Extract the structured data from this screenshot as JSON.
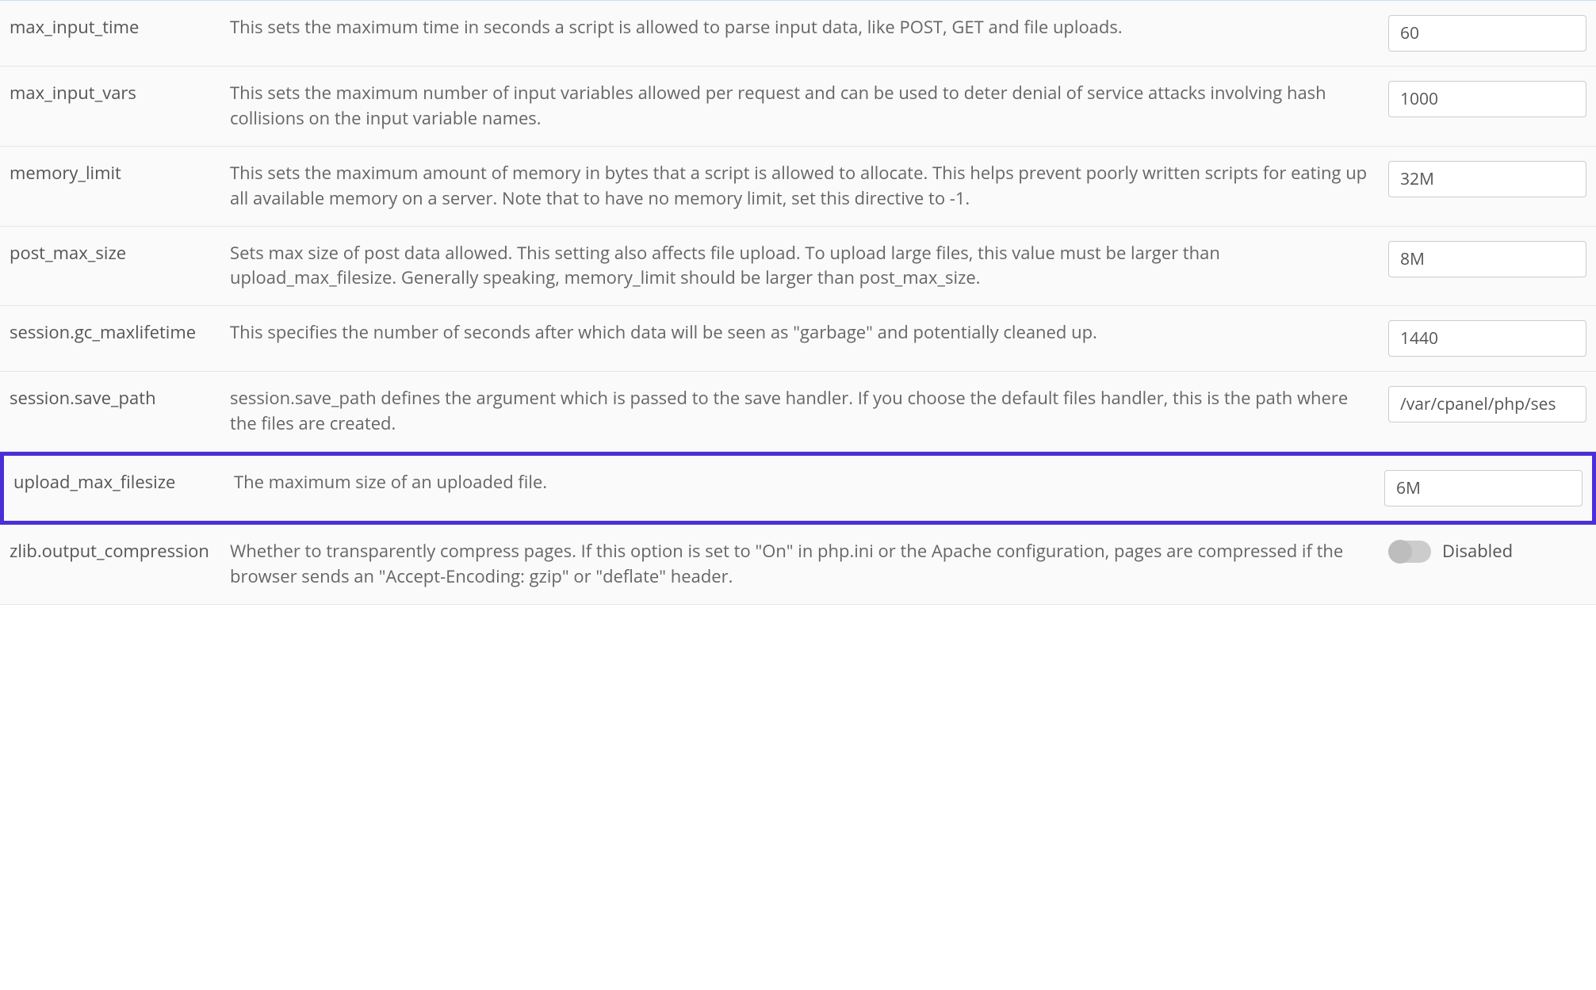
{
  "settings": [
    {
      "name": "max_input_time",
      "description": "This sets the maximum time in seconds a script is allowed to parse input data, like POST, GET and file uploads.",
      "value": "60",
      "type": "text",
      "highlighted": false
    },
    {
      "name": "max_input_vars",
      "description": "This sets the maximum number of input variables allowed per request and can be used to deter denial of service attacks involving hash collisions on the input variable names.",
      "value": "1000",
      "type": "text",
      "highlighted": false
    },
    {
      "name": "memory_limit",
      "description": "This sets the maximum amount of memory in bytes that a script is allowed to allocate. This helps prevent poorly written scripts for eating up all available memory on a server. Note that to have no memory limit, set this directive to -1.",
      "value": "32M",
      "type": "text",
      "highlighted": false
    },
    {
      "name": "post_max_size",
      "description": "Sets max size of post data allowed. This setting also affects file upload. To upload large files, this value must be larger than upload_max_filesize. Generally speaking, memory_limit should be larger than post_max_size.",
      "value": "8M",
      "type": "text",
      "highlighted": false
    },
    {
      "name": "session.gc_maxlifetime",
      "description": "This specifies the number of seconds after which data will be seen as \"garbage\" and potentially cleaned up.",
      "value": "1440",
      "type": "text",
      "highlighted": false
    },
    {
      "name": "session.save_path",
      "description": "session.save_path defines the argument which is passed to the save handler. If you choose the default files handler, this is the path where the files are created.",
      "value": "/var/cpanel/php/ses",
      "type": "text",
      "highlighted": false
    },
    {
      "name": "upload_max_filesize",
      "description": "The maximum size of an uploaded file.",
      "value": "6M",
      "type": "text",
      "highlighted": true
    },
    {
      "name": "zlib.output_compression",
      "description": "Whether to transparently compress pages. If this option is set to \"On\" in php.ini or the Apache configuration, pages are compressed if the browser sends an \"Accept-Encoding: gzip\" or \"deflate\" header.",
      "value": "Disabled",
      "type": "toggle",
      "highlighted": false
    }
  ]
}
